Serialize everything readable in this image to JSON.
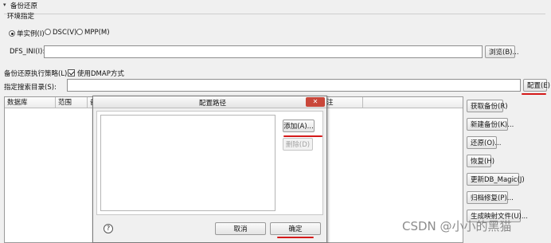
{
  "section_title": "备份还原",
  "env": {
    "group_label": "环境指定",
    "radios": [
      {
        "label": "单实例(I)",
        "checked": true
      },
      {
        "label": "DSC(V)",
        "checked": false
      },
      {
        "label": "MPP(M)",
        "checked": false
      }
    ],
    "dfs_label": "DFS_INI(I):",
    "dfs_value": "",
    "browse_label": "浏览(B)..."
  },
  "strategy": {
    "label": "备份还原执行策略(L):",
    "dmap_label": "使用DMAP方式",
    "dmap_checked": true
  },
  "search_dir": {
    "label": "指定搜索目录(S):",
    "value": "",
    "config_label": "配置(E)"
  },
  "table": {
    "columns": [
      "数据库",
      "范围",
      "备"
    ],
    "hidden_tail": "注"
  },
  "right_buttons": [
    "获取备份(R)",
    "新建备份(K)...",
    "还原(O)...",
    "恢复(H)",
    "更新DB_Magic(J)",
    "归档修复(P)...",
    "生成映射文件(U)..."
  ],
  "dialog": {
    "title": "配置路径",
    "close_glyph": "✕",
    "add_label": "添加(A)...",
    "delete_label": "删除(D)",
    "help_glyph": "?",
    "cancel_label": "取消",
    "ok_label": "确定"
  },
  "watermark": "CSDN @小小的黑猫",
  "colors": {
    "accent_red": "#d41a1a",
    "dialog_close_bg": "#c9473a"
  }
}
